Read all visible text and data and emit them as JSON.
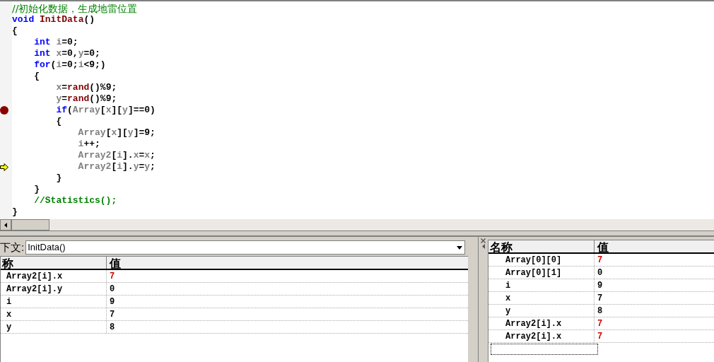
{
  "editor": {
    "lines": [
      {
        "breakpoint": false,
        "current": false,
        "tokens": [
          {
            "text": "//初始化数据，生成地雷位置",
            "kind": "comment"
          }
        ]
      },
      {
        "breakpoint": false,
        "current": false,
        "tokens": [
          {
            "text": "void",
            "kind": "keyword"
          },
          {
            "text": " InitData",
            "kind": "function"
          },
          {
            "text": "()",
            "kind": "plain"
          }
        ]
      },
      {
        "breakpoint": false,
        "current": false,
        "tokens": [
          {
            "text": "{",
            "kind": "plain"
          }
        ]
      },
      {
        "breakpoint": false,
        "current": false,
        "tokens": [
          {
            "text": "    int",
            "kind": "keyword"
          },
          {
            "text": " i",
            "kind": "variable"
          },
          {
            "text": "=0;",
            "kind": "plain"
          }
        ]
      },
      {
        "breakpoint": false,
        "current": false,
        "tokens": [
          {
            "text": "    int",
            "kind": "keyword"
          },
          {
            "text": " x",
            "kind": "variable"
          },
          {
            "text": "=0,",
            "kind": "plain"
          },
          {
            "text": "y",
            "kind": "variable"
          },
          {
            "text": "=0;",
            "kind": "plain"
          }
        ]
      },
      {
        "breakpoint": false,
        "current": false,
        "tokens": [
          {
            "text": "    for",
            "kind": "keyword"
          },
          {
            "text": "(",
            "kind": "plain"
          },
          {
            "text": "i",
            "kind": "variable"
          },
          {
            "text": "=0;",
            "kind": "plain"
          },
          {
            "text": "i",
            "kind": "variable"
          },
          {
            "text": "<9;)",
            "kind": "plain"
          }
        ]
      },
      {
        "breakpoint": false,
        "current": false,
        "tokens": [
          {
            "text": "    {",
            "kind": "plain"
          }
        ]
      },
      {
        "breakpoint": false,
        "current": false,
        "tokens": [
          {
            "text": "        x",
            "kind": "variable"
          },
          {
            "text": "=",
            "kind": "plain"
          },
          {
            "text": "rand",
            "kind": "function"
          },
          {
            "text": "()%9;",
            "kind": "plain"
          }
        ]
      },
      {
        "breakpoint": false,
        "current": false,
        "tokens": [
          {
            "text": "        y",
            "kind": "variable"
          },
          {
            "text": "=",
            "kind": "plain"
          },
          {
            "text": "rand",
            "kind": "function"
          },
          {
            "text": "()%9;",
            "kind": "plain"
          }
        ]
      },
      {
        "breakpoint": true,
        "current": false,
        "tokens": [
          {
            "text": "        if",
            "kind": "keyword"
          },
          {
            "text": "(",
            "kind": "plain"
          },
          {
            "text": "Array",
            "kind": "variable"
          },
          {
            "text": "[",
            "kind": "plain"
          },
          {
            "text": "x",
            "kind": "variable"
          },
          {
            "text": "][",
            "kind": "plain"
          },
          {
            "text": "y",
            "kind": "variable"
          },
          {
            "text": "]==0)",
            "kind": "plain"
          }
        ]
      },
      {
        "breakpoint": false,
        "current": false,
        "tokens": [
          {
            "text": "        {",
            "kind": "plain"
          }
        ]
      },
      {
        "breakpoint": false,
        "current": false,
        "tokens": [
          {
            "text": "            Array",
            "kind": "variable"
          },
          {
            "text": "[",
            "kind": "plain"
          },
          {
            "text": "x",
            "kind": "variable"
          },
          {
            "text": "][",
            "kind": "plain"
          },
          {
            "text": "y",
            "kind": "variable"
          },
          {
            "text": "]=9;",
            "kind": "plain"
          }
        ]
      },
      {
        "breakpoint": false,
        "current": false,
        "tokens": [
          {
            "text": "            i",
            "kind": "variable"
          },
          {
            "text": "++;",
            "kind": "plain"
          }
        ]
      },
      {
        "breakpoint": false,
        "current": false,
        "tokens": [
          {
            "text": "            Array2",
            "kind": "variable"
          },
          {
            "text": "[",
            "kind": "plain"
          },
          {
            "text": "i",
            "kind": "variable"
          },
          {
            "text": "].",
            "kind": "plain"
          },
          {
            "text": "x",
            "kind": "variable"
          },
          {
            "text": "=",
            "kind": "plain"
          },
          {
            "text": "x",
            "kind": "variable"
          },
          {
            "text": ";",
            "kind": "plain"
          }
        ]
      },
      {
        "breakpoint": false,
        "current": true,
        "tokens": [
          {
            "text": "            Array2",
            "kind": "variable"
          },
          {
            "text": "[",
            "kind": "plain"
          },
          {
            "text": "i",
            "kind": "variable"
          },
          {
            "text": "].",
            "kind": "plain"
          },
          {
            "text": "y",
            "kind": "variable"
          },
          {
            "text": "=",
            "kind": "plain"
          },
          {
            "text": "y",
            "kind": "variable"
          },
          {
            "text": ";",
            "kind": "plain"
          }
        ]
      },
      {
        "breakpoint": false,
        "current": false,
        "tokens": [
          {
            "text": "        }",
            "kind": "plain"
          }
        ]
      },
      {
        "breakpoint": false,
        "current": false,
        "tokens": [
          {
            "text": "    }",
            "kind": "plain"
          }
        ]
      },
      {
        "breakpoint": false,
        "current": false,
        "tokens": [
          {
            "text": "    //Statistics();",
            "kind": "comment"
          }
        ]
      },
      {
        "breakpoint": false,
        "current": false,
        "tokens": [
          {
            "text": "}",
            "kind": "plain"
          }
        ]
      }
    ]
  },
  "variables_pane": {
    "context_label": "下文:",
    "context_value": "InitData()",
    "columns": [
      "称",
      "值"
    ],
    "rows": [
      {
        "name": "Array2[i].x",
        "value": "7",
        "changed": true
      },
      {
        "name": "Array2[i].y",
        "value": "0",
        "changed": false
      },
      {
        "name": "i",
        "value": "9",
        "changed": false
      },
      {
        "name": "x",
        "value": "7",
        "changed": false
      },
      {
        "name": "y",
        "value": "8",
        "changed": false
      }
    ]
  },
  "watch_pane": {
    "columns": [
      "名称",
      "值"
    ],
    "rows": [
      {
        "name": "Array[0][0]",
        "value": "7",
        "changed": true
      },
      {
        "name": "Array[0][1]",
        "value": "0",
        "changed": false
      },
      {
        "name": "i",
        "value": "9",
        "changed": false
      },
      {
        "name": "x",
        "value": "7",
        "changed": false
      },
      {
        "name": "y",
        "value": "8",
        "changed": false
      },
      {
        "name": "Array2[i].x",
        "value": "7",
        "changed": true
      },
      {
        "name": "Array2[i].x",
        "value": "7",
        "changed": true
      }
    ]
  }
}
